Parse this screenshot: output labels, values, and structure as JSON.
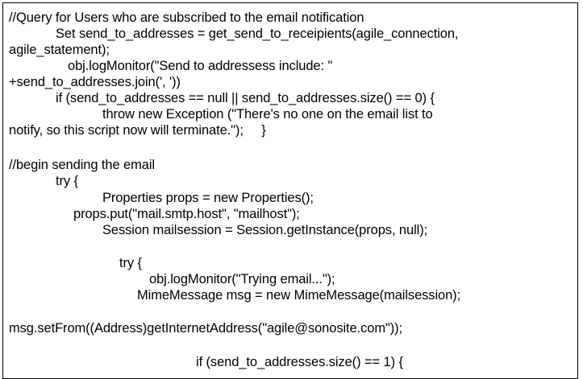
{
  "document": {
    "lines": [
      "//Query for Users who are subscribed to the email notification",
      "Set send_to_addresses = get_send_to_receipients(agile_connection,",
      "agile_statement);",
      "obj.logMonitor(\"Send to addressess include: \"",
      "+send_to_addresses.join(', '))",
      "if (send_to_addresses == null || send_to_addresses.size() == 0) {",
      "throw new Exception (\"There's no one on the email list to",
      "notify, so this script now will terminate.\");     }",
      "//begin sending the email",
      "try {",
      "Properties props = new Properties();",
      "props.put(\"mail.smtp.host\", \"mailhost\");",
      "Session mailsession = Session.getInstance(props, null);",
      "try {",
      "obj.logMonitor(\"Trying email...\");",
      "MimeMessage msg = new MimeMessage(mailsession);",
      "msg.setFrom((Address)getInternetAddress(\"agile@sonosite.com\"));",
      "if (send_to_addresses.size() == 1) {"
    ]
  }
}
